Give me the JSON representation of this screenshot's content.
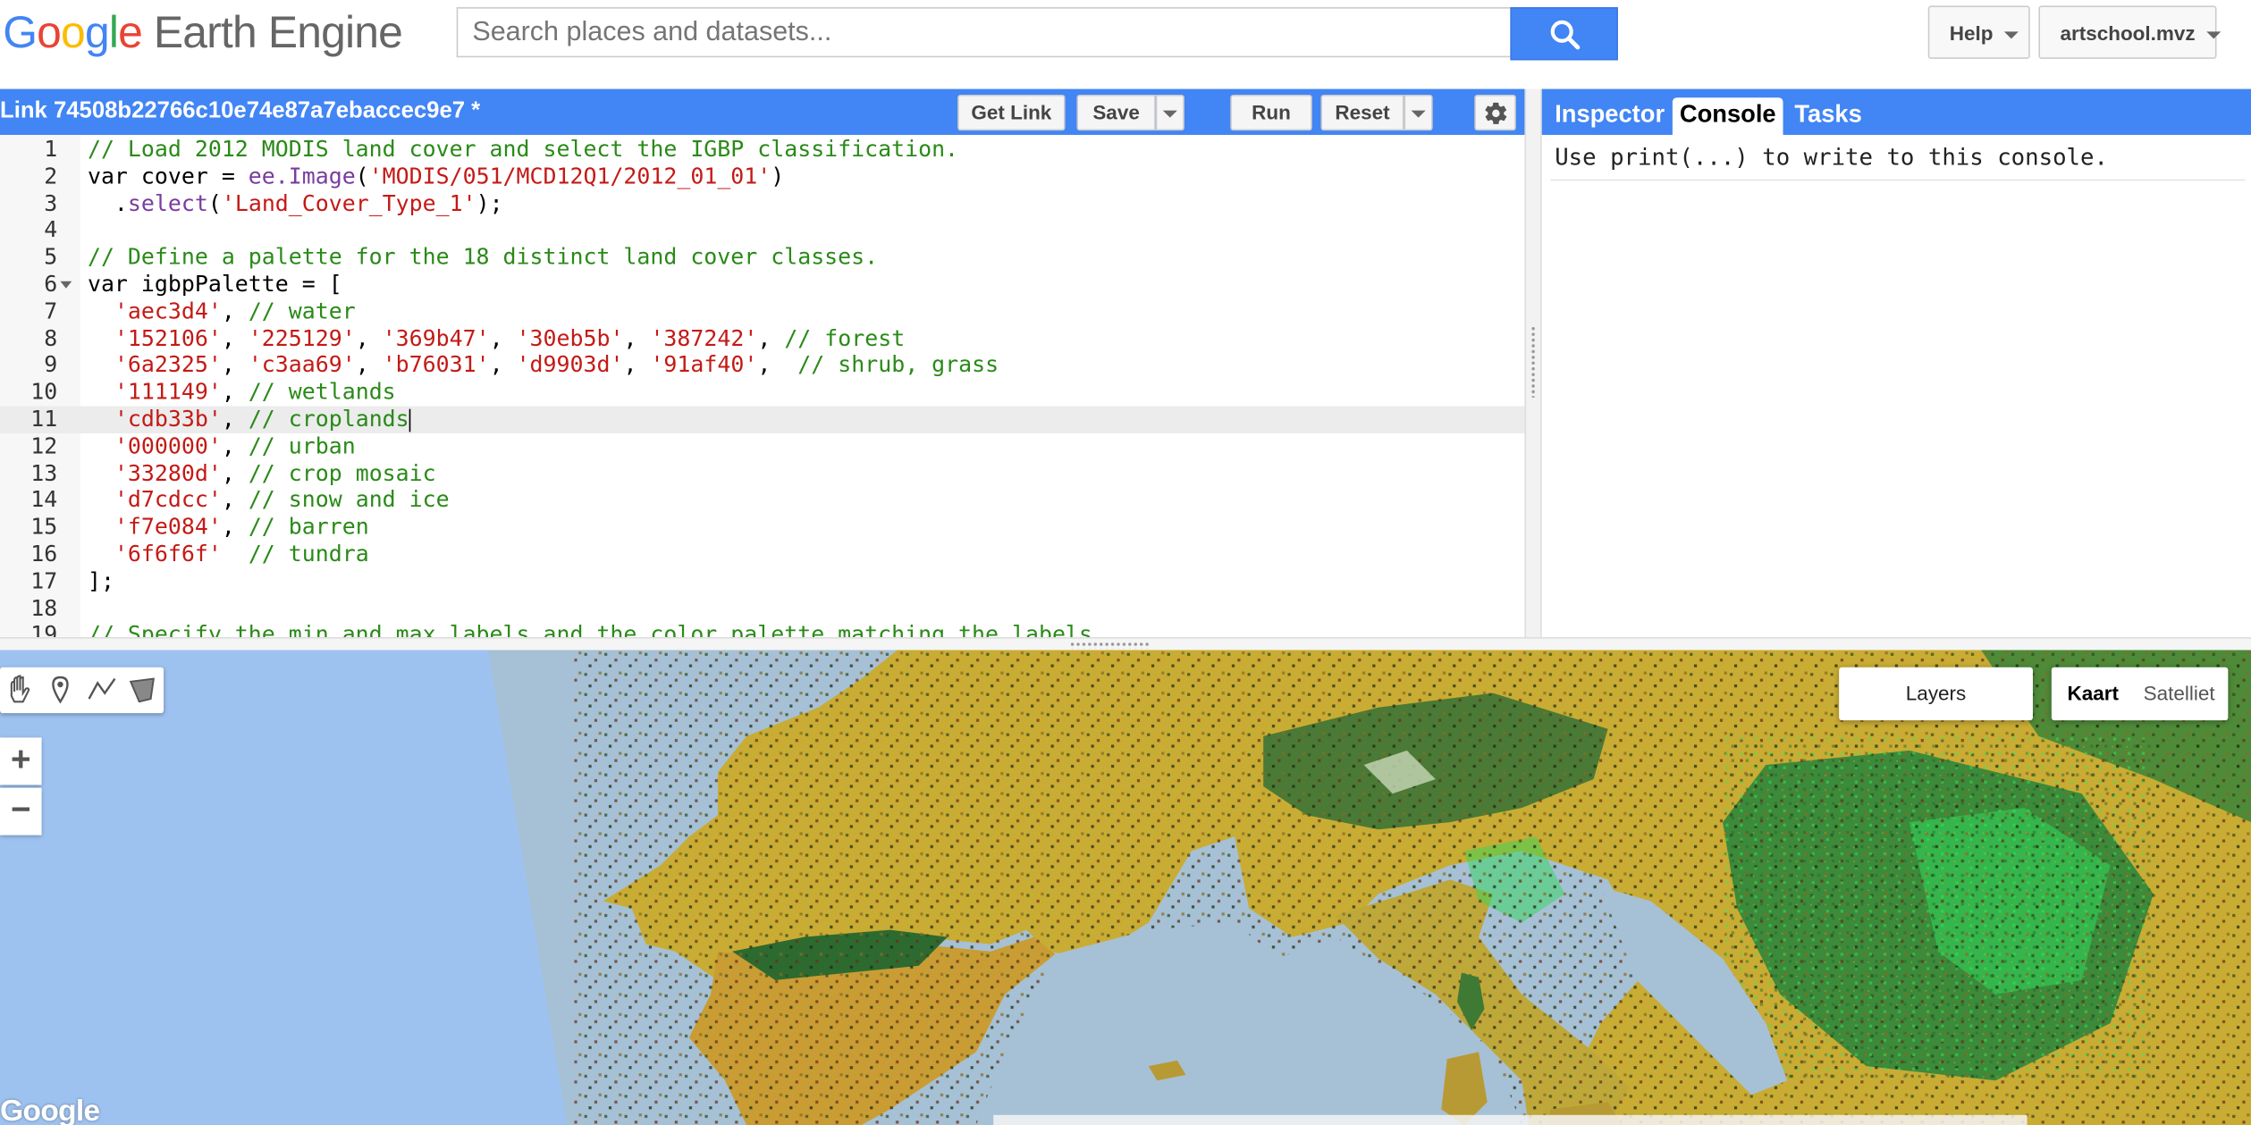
{
  "header": {
    "logo": {
      "g1": "G",
      "g2": "o",
      "g3": "o",
      "g4": "g",
      "g5": "l",
      "g6": "e",
      "rest": "Earth Engine"
    },
    "search_placeholder": "Search places and datasets...",
    "help_label": "Help",
    "account_label": "artschool.mvz"
  },
  "editor": {
    "title": "Link 74508b22766c10e74e87a7ebaccec9e7 *",
    "get_link_label": "Get Link",
    "save_label": "Save",
    "run_label": "Run",
    "reset_label": "Reset",
    "lines": [
      {
        "n": "1",
        "segs": [
          {
            "t": "c",
            "v": "// Load 2012 MODIS land cover and select the IGBP classification."
          }
        ]
      },
      {
        "n": "2",
        "segs": [
          {
            "t": "k",
            "v": "var cover = "
          },
          {
            "t": "f",
            "v": "ee.Image"
          },
          {
            "t": "k",
            "v": "("
          },
          {
            "t": "s",
            "v": "'MODIS/051/MCD12Q1/2012_01_01'"
          },
          {
            "t": "k",
            "v": ")"
          }
        ]
      },
      {
        "n": "3",
        "segs": [
          {
            "t": "k",
            "v": "  ."
          },
          {
            "t": "f",
            "v": "select"
          },
          {
            "t": "k",
            "v": "("
          },
          {
            "t": "s",
            "v": "'Land_Cover_Type_1'"
          },
          {
            "t": "k",
            "v": ");"
          }
        ]
      },
      {
        "n": "4",
        "segs": []
      },
      {
        "n": "5",
        "segs": [
          {
            "t": "c",
            "v": "// Define a palette for the 18 distinct land cover classes."
          }
        ]
      },
      {
        "n": "6",
        "fold": true,
        "segs": [
          {
            "t": "k",
            "v": "var igbpPalette = ["
          }
        ]
      },
      {
        "n": "7",
        "segs": [
          {
            "t": "k",
            "v": "  "
          },
          {
            "t": "s",
            "v": "'aec3d4'"
          },
          {
            "t": "k",
            "v": ", "
          },
          {
            "t": "c",
            "v": "// water"
          }
        ]
      },
      {
        "n": "8",
        "segs": [
          {
            "t": "k",
            "v": "  "
          },
          {
            "t": "s",
            "v": "'152106'"
          },
          {
            "t": "k",
            "v": ", "
          },
          {
            "t": "s",
            "v": "'225129'"
          },
          {
            "t": "k",
            "v": ", "
          },
          {
            "t": "s",
            "v": "'369b47'"
          },
          {
            "t": "k",
            "v": ", "
          },
          {
            "t": "s",
            "v": "'30eb5b'"
          },
          {
            "t": "k",
            "v": ", "
          },
          {
            "t": "s",
            "v": "'387242'"
          },
          {
            "t": "k",
            "v": ", "
          },
          {
            "t": "c",
            "v": "// forest"
          }
        ]
      },
      {
        "n": "9",
        "segs": [
          {
            "t": "k",
            "v": "  "
          },
          {
            "t": "s",
            "v": "'6a2325'"
          },
          {
            "t": "k",
            "v": ", "
          },
          {
            "t": "s",
            "v": "'c3aa69'"
          },
          {
            "t": "k",
            "v": ", "
          },
          {
            "t": "s",
            "v": "'b76031'"
          },
          {
            "t": "k",
            "v": ", "
          },
          {
            "t": "s",
            "v": "'d9903d'"
          },
          {
            "t": "k",
            "v": ", "
          },
          {
            "t": "s",
            "v": "'91af40'"
          },
          {
            "t": "k",
            "v": ",  "
          },
          {
            "t": "c",
            "v": "// shrub, grass"
          }
        ]
      },
      {
        "n": "10",
        "segs": [
          {
            "t": "k",
            "v": "  "
          },
          {
            "t": "s",
            "v": "'111149'"
          },
          {
            "t": "k",
            "v": ", "
          },
          {
            "t": "c",
            "v": "// wetlands"
          }
        ]
      },
      {
        "n": "11",
        "active": true,
        "segs": [
          {
            "t": "k",
            "v": "  "
          },
          {
            "t": "s",
            "v": "'cdb33b'"
          },
          {
            "t": "k",
            "v": ", "
          },
          {
            "t": "c",
            "v": "// croplands"
          }
        ]
      },
      {
        "n": "12",
        "segs": [
          {
            "t": "k",
            "v": "  "
          },
          {
            "t": "s",
            "v": "'000000'"
          },
          {
            "t": "k",
            "v": ", "
          },
          {
            "t": "c",
            "v": "// urban"
          }
        ]
      },
      {
        "n": "13",
        "segs": [
          {
            "t": "k",
            "v": "  "
          },
          {
            "t": "s",
            "v": "'33280d'"
          },
          {
            "t": "k",
            "v": ", "
          },
          {
            "t": "c",
            "v": "// crop mosaic"
          }
        ]
      },
      {
        "n": "14",
        "segs": [
          {
            "t": "k",
            "v": "  "
          },
          {
            "t": "s",
            "v": "'d7cdcc'"
          },
          {
            "t": "k",
            "v": ", "
          },
          {
            "t": "c",
            "v": "// snow and ice"
          }
        ]
      },
      {
        "n": "15",
        "segs": [
          {
            "t": "k",
            "v": "  "
          },
          {
            "t": "s",
            "v": "'f7e084'"
          },
          {
            "t": "k",
            "v": ", "
          },
          {
            "t": "c",
            "v": "// barren"
          }
        ]
      },
      {
        "n": "16",
        "segs": [
          {
            "t": "k",
            "v": "  "
          },
          {
            "t": "s",
            "v": "'6f6f6f'"
          },
          {
            "t": "k",
            "v": "  "
          },
          {
            "t": "c",
            "v": "// tundra"
          }
        ]
      },
      {
        "n": "17",
        "segs": [
          {
            "t": "k",
            "v": "];"
          }
        ]
      },
      {
        "n": "18",
        "segs": []
      },
      {
        "n": "19",
        "segs": [
          {
            "t": "c",
            "v": "// Specify the min and max labels and the color palette matching the labels."
          }
        ]
      }
    ]
  },
  "right_panel": {
    "tabs": [
      {
        "label": "Inspector",
        "active": false
      },
      {
        "label": "Console",
        "active": true
      },
      {
        "label": "Tasks",
        "active": false
      }
    ],
    "console_message": "Use print(...) to write to this console."
  },
  "map": {
    "layers_label": "Layers",
    "map_type_map": "Kaart",
    "map_type_satellite": "Satelliet",
    "zoom_in": "+",
    "zoom_out": "−",
    "google_logo": "Google"
  },
  "colors": {
    "accent": "#4285f4",
    "ocean": "#a6c1d6",
    "cropland": "#cdb33b",
    "forest": "#387242",
    "bright_forest": "#30eb5b"
  }
}
